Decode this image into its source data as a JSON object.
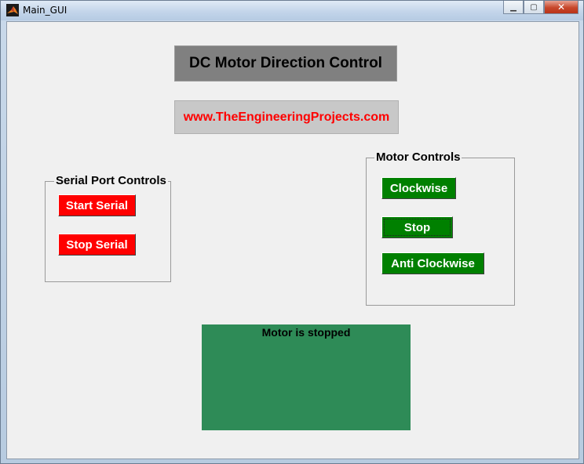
{
  "window": {
    "title": "Main_GUI",
    "buttons": {
      "minimize": "▁",
      "maximize": "▢",
      "close": "✕"
    }
  },
  "header": {
    "title": "DC Motor Direction Control",
    "url": "www.TheEngineeringProjects.com"
  },
  "serial_group": {
    "title": "Serial Port Controls",
    "start_label": "Start Serial",
    "stop_label": "Stop Serial"
  },
  "motor_group": {
    "title": "Motor Controls",
    "clockwise_label": "Clockwise",
    "stop_label": "Stop",
    "anticlockwise_label": "Anti Clockwise"
  },
  "status": {
    "text": "Motor is stopped"
  },
  "colors": {
    "red_button": "#ff0000",
    "green_button": "#008000",
    "status_panel": "#2e8b57",
    "url_text": "#ff0000",
    "title_bg": "#808080"
  },
  "icons": {
    "app": "matlab-icon"
  }
}
